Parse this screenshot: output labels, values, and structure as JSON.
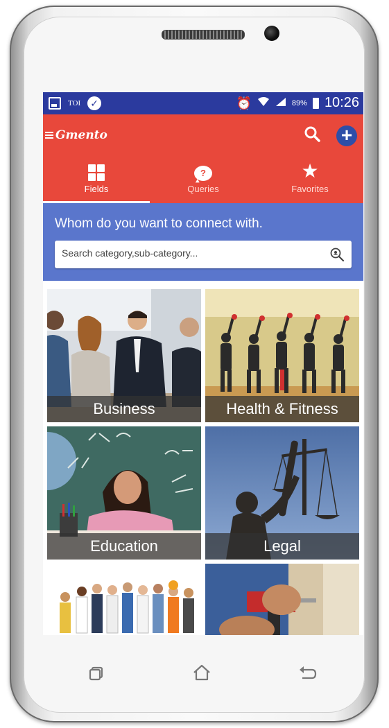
{
  "status_bar": {
    "left_label": "TOI",
    "battery": "89%",
    "time": "10:26"
  },
  "app_bar": {
    "logo": "Gmento"
  },
  "tabs": [
    {
      "label": "Fields",
      "icon": "grid-icon",
      "active": true
    },
    {
      "label": "Queries",
      "icon": "question-bubble-icon",
      "active": false
    },
    {
      "label": "Favorites",
      "icon": "star-icon",
      "active": false
    }
  ],
  "hero": {
    "title": "Whom do you want to connect with.",
    "search_placeholder": "Search category,sub-category..."
  },
  "categories": [
    {
      "label": "Business"
    },
    {
      "label": "Health & Fitness"
    },
    {
      "label": "Education"
    },
    {
      "label": "Legal"
    },
    {
      "label": ""
    },
    {
      "label": ""
    }
  ],
  "colors": {
    "status_bar": "#2b3a9e",
    "app_bar": "#e8483b",
    "hero": "#5a76cc",
    "add_button": "#2e4ea8"
  }
}
